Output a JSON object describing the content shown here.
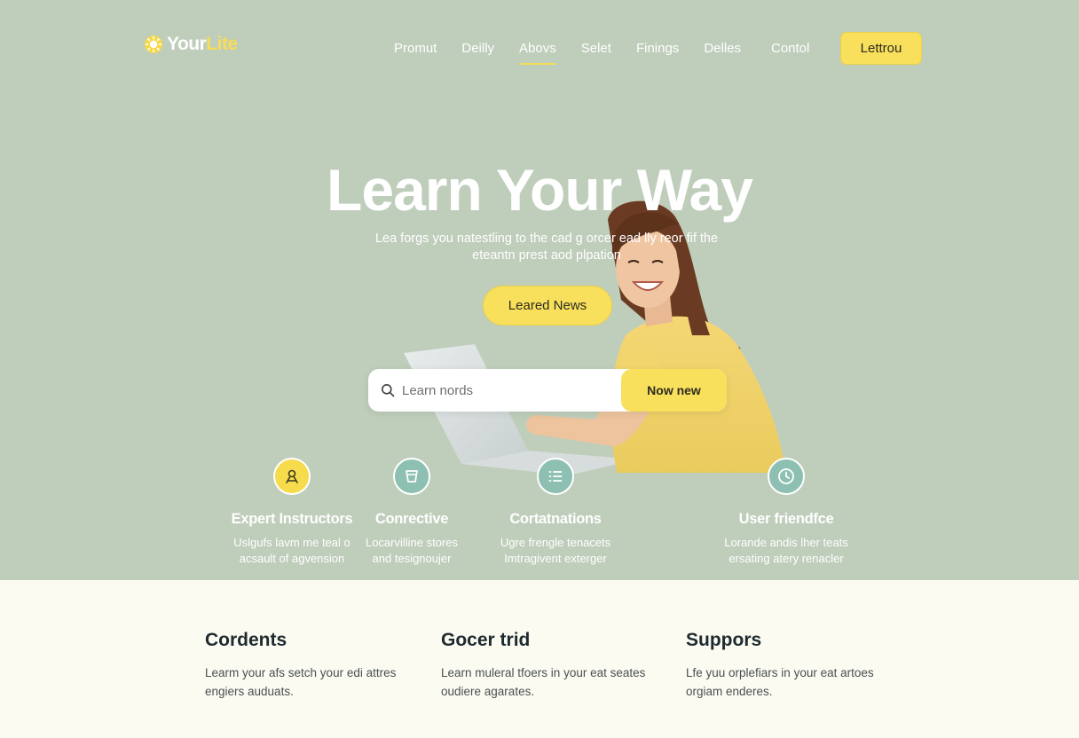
{
  "brand": {
    "name_main": "Your",
    "name_accent": "Lite"
  },
  "nav": {
    "items": [
      {
        "label": "Promut"
      },
      {
        "label": "Deilly"
      },
      {
        "label": "Abovs"
      },
      {
        "label": "Selet"
      },
      {
        "label": "Finings"
      },
      {
        "label": "Delles"
      },
      {
        "label": "Contol"
      }
    ],
    "active_index": 2,
    "cta_label": "Lettrou"
  },
  "hero": {
    "title": "Learn Your Way",
    "subtitle_line1": "Lea forgs you natestling to the cad g orcer ead lly reor fif the",
    "subtitle_line2": "eteantn prest aod plpation",
    "cta_label": "Leared News"
  },
  "search": {
    "placeholder": "Learn nords",
    "button_label": "Now new"
  },
  "features": [
    {
      "title": "Expert Instructors",
      "line1": "Uslgufs lavm me teal o",
      "line2": "acsault of agvension",
      "icon": "instructor-icon",
      "icon_color": "#f6dc4c"
    },
    {
      "title": "Conrective",
      "line1": "Locarvilline stores",
      "line2": "and tesignoujer",
      "icon": "cup-icon",
      "icon_color": "#8dc0b2"
    },
    {
      "title": "Cortatnations",
      "line1": "Ugre frengle tenacets",
      "line2": "Imtragivent exterger",
      "icon": "list-icon",
      "icon_color": "#8dc0b2"
    },
    {
      "title": "User friendfce",
      "line1": "Lorande andis lher teats",
      "line2": "ersating atery renacler",
      "icon": "clock-icon",
      "icon_color": "#8dc0b2"
    }
  ],
  "columns": [
    {
      "title": "Cordents",
      "line1": "Learm your afs setch your edi attres",
      "line2": "engiers auduats."
    },
    {
      "title": "Gocer trid",
      "line1": "Learn muleral tfoers in your eat seates",
      "line2": "oudiere agarates."
    },
    {
      "title": "Suppors",
      "line1": "Lfe yuu orplefiars in your eat artoes",
      "line2": "orgiam enderes."
    }
  ],
  "colors": {
    "hero_background": "#bfcdbb",
    "accent_yellow": "#f8df5c",
    "teal": "#8dc0b2",
    "page_background": "#fbfbf1"
  }
}
